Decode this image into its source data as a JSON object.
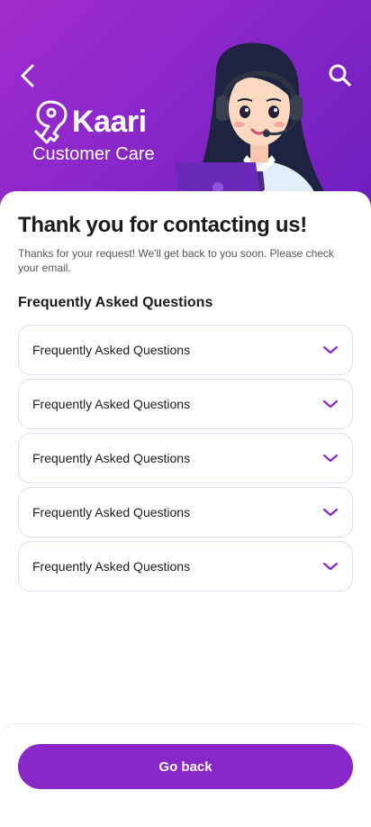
{
  "header": {
    "back_icon": "chevron-left-icon",
    "search_icon": "search-icon",
    "brand_name": "Kaari",
    "brand_subtitle": "Customer Care",
    "gradient_colors": [
      "#a12ccd",
      "#6d1fc0"
    ]
  },
  "main": {
    "title": "Thank you for contacting us!",
    "message": "Thanks for your request! We'll get back to you soon. Please check your email.",
    "faq_heading": "Frequently Asked Questions",
    "faq_items": [
      {
        "label": "Frequently Asked Questions",
        "icon": "chevron-down-icon"
      },
      {
        "label": "Frequently Asked Questions",
        "icon": "chevron-down-icon"
      },
      {
        "label": "Frequently Asked Questions",
        "icon": "chevron-down-icon"
      },
      {
        "label": "Frequently Asked Questions",
        "icon": "chevron-down-icon"
      },
      {
        "label": "Frequently Asked Questions",
        "icon": "chevron-down-icon"
      }
    ]
  },
  "footer": {
    "go_back_label": "Go back"
  },
  "colors": {
    "accent": "#8a27c9",
    "border": "#e6dcef"
  }
}
